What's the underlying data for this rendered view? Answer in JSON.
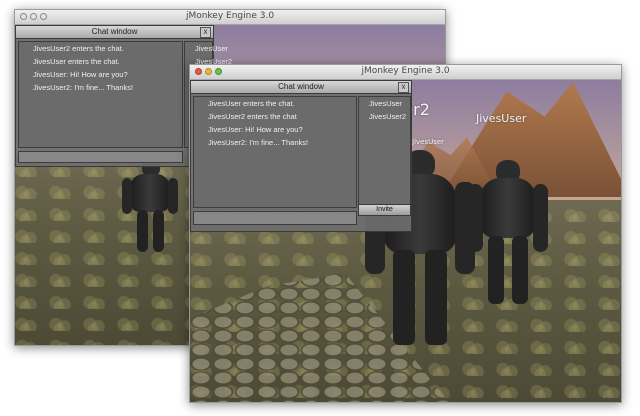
{
  "back_window": {
    "title": "jMonkey Engine 3.0",
    "chat": {
      "title": "Chat window",
      "close_label": "x",
      "messages": [
        "JivesUser2 enters the chat.",
        "JivesUser enters the chat.",
        "JivesUser: Hi! How are you?",
        "JivesUser2: I'm fine... Thanks!"
      ],
      "users": [
        "JivesUser",
        "JivesUser2"
      ]
    }
  },
  "front_window": {
    "title": "jMonkey Engine 3.0",
    "chat": {
      "title": "Chat window",
      "close_label": "x",
      "messages": [
        "JivesUser enters the chat.",
        "JivesUser2 enters the chat",
        "JivesUser: Hi! How are you?",
        "JivesUser2: I'm fine... Thanks!"
      ],
      "users": [
        "JivesUser",
        "JivesUser2"
      ],
      "invite_label": "Invite"
    },
    "scene_labels": {
      "big": "ser2",
      "right": "JivesUser",
      "small": "JivesUser"
    }
  }
}
